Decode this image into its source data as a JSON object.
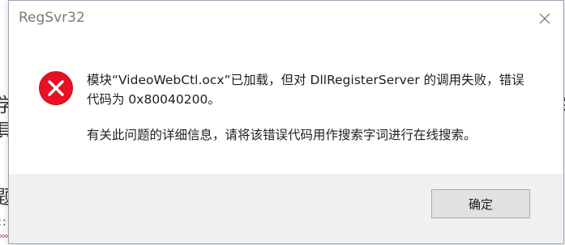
{
  "background": {
    "fragments": [
      "学",
      "具",
      "题",
      "∷",
      "关"
    ]
  },
  "dialog": {
    "title": "RegSvr32",
    "close_icon": "close-icon",
    "error_icon": "error-icon",
    "message_line1": "模块“VideoWebCtl.ocx”已加载，但对 DllRegisterServer 的调用失败，错误代码为 0x80040200。",
    "message_line2": "有关此问题的详细信息，请将该错误代码用作搜索字词进行在线搜索。",
    "ok_label": "确定"
  },
  "colors": {
    "error_red": "#e81123",
    "footer_bg": "#f0f0f0",
    "button_bg": "#e1e1e1"
  }
}
